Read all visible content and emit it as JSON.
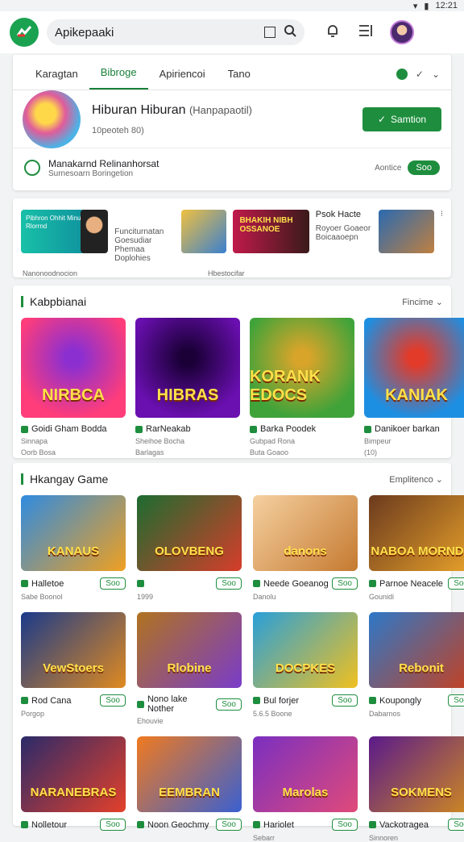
{
  "status": {
    "time": "12:21"
  },
  "search": {
    "text": "Apikepaaki"
  },
  "tabs": [
    {
      "label": "Karagtan"
    },
    {
      "label": "Bibroge"
    },
    {
      "label": "Apiriencoi"
    },
    {
      "label": "Tano"
    }
  ],
  "profile": {
    "title": "Hiburan Hiburan",
    "title_extra": "(Hanpapaotil)",
    "subtitle": "10peoteh 80)",
    "button": "Samtion"
  },
  "promo": {
    "title": "Manakarnd Relinanhorsat",
    "subtitle": "Surnesoarn Boringetion",
    "right_label": "Aontice",
    "button": "Soo"
  },
  "featured": {
    "item1_title": "Pibhron Ohhit Minuted Rlorrnd",
    "item2_text": "Funciturnatan Goesudiar Phemaa Doplohies",
    "item3_title": "Psok Hacte",
    "item3_text": "Royoer Goaeor Boicaaoepn",
    "caption_left": "Nanonoodnocion",
    "caption_mid": "Hbestocifar",
    "banner_text": "BHAKIH NIBH OSSANOE"
  },
  "section1": {
    "title": "Kabpbianai",
    "more": "Fincime",
    "games": [
      {
        "art": "NIRBCA",
        "name": "Goidi Gham Bodda",
        "meta1": "Sinnapa",
        "meta2": "Oorb Bosa",
        "colors": [
          "#ff3d7a",
          "#8b2fd1"
        ]
      },
      {
        "art": "HIBRAS",
        "name": "RarNeakab",
        "meta1": "Sheihoe Bocha",
        "meta2": "Barlagas",
        "colors": [
          "#6a0fb0",
          "#1b0038"
        ]
      },
      {
        "art": "KORANK EDOCS",
        "name": "Barka Poodek",
        "meta1": "Gubpad Rona",
        "meta2": "Buta Goaoo",
        "colors": [
          "#3fa33a",
          "#d8a42a"
        ]
      },
      {
        "art": "KANIAK",
        "name": "Danikoer barkan",
        "meta1": "Bimpeur",
        "meta2": "(10)",
        "colors": [
          "#1d8fe2",
          "#e23b2a"
        ]
      }
    ]
  },
  "section2": {
    "title": "Hkangay Game",
    "more": "Emplitenco",
    "button": "Soo",
    "rows": [
      [
        {
          "art": "KANAUS",
          "name": "Halletoe",
          "meta": "Sabe Boonol",
          "colors": [
            "#2f8be0",
            "#f0a020"
          ]
        },
        {
          "art": "OLOVBENG",
          "name": "",
          "meta": "1999",
          "colors": [
            "#1c6c30",
            "#d63d2a"
          ]
        },
        {
          "art": "danons",
          "name": "Neede Goeanog",
          "meta": "Danolu",
          "colors": [
            "#f5d0a0",
            "#c57a30"
          ]
        },
        {
          "art": "NABOA MORNDS",
          "name": "Parnoe Neacele",
          "meta": "Gounidi",
          "colors": [
            "#6b3a1e",
            "#e8a22a"
          ]
        }
      ],
      [
        {
          "art": "VewStoers",
          "name": "Rod Cana",
          "meta": "Porgop",
          "colors": [
            "#1a3a8a",
            "#e08a20"
          ]
        },
        {
          "art": "Rlobine",
          "name": "Nono lake Nother",
          "meta": "Ehouvie",
          "colors": [
            "#b0731f",
            "#7a3cc9"
          ]
        },
        {
          "art": "DOCPKES",
          "name": "Bul forjer",
          "meta": "5.6.5 Boone",
          "colors": [
            "#29a0d9",
            "#f0c020"
          ]
        },
        {
          "art": "Rebonit",
          "name": "Koupongly",
          "meta": "Dabarnos",
          "colors": [
            "#2d78c8",
            "#c7401f"
          ]
        }
      ],
      [
        {
          "art": "NARANEBRAS",
          "name": "Nolletour",
          "meta": "",
          "colors": [
            "#2a2a6a",
            "#e4402a"
          ]
        },
        {
          "art": "EEMBRAN",
          "name": "Noon Geochmy",
          "meta": "",
          "colors": [
            "#f07a20",
            "#3a60d0"
          ]
        },
        {
          "art": "Marolas",
          "name": "Hariolet",
          "meta": "Sebarr",
          "colors": [
            "#7a2fc0",
            "#e04a7a"
          ]
        },
        {
          "art": "SOKMENS",
          "name": "Vackotragea",
          "meta": "Sinnoren",
          "colors": [
            "#5a1a8a",
            "#d08a20"
          ]
        }
      ]
    ]
  }
}
